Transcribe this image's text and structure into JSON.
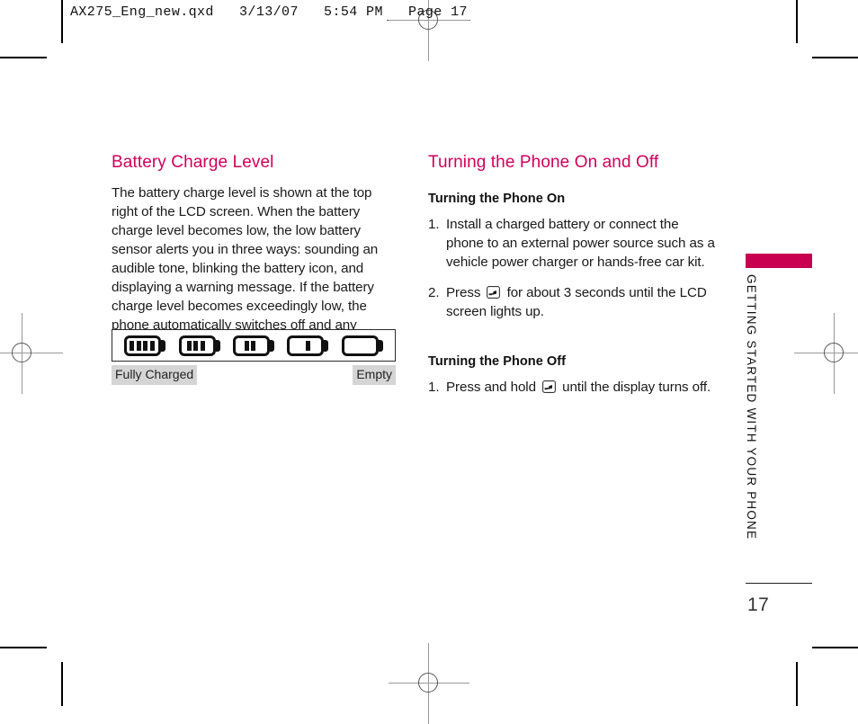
{
  "slug": "AX275_Eng_new.qxd   3/13/07   5:54 PM   Page 17",
  "colors": {
    "heading_crimson": "#d2005a",
    "tab_accent": "#c8004f",
    "label_chip_gray": "#d5d5d5",
    "body_text": "#1a1a1a"
  },
  "left_column": {
    "heading": "Battery Charge Level",
    "paragraph": "The battery charge level is shown at the top right of the LCD screen. When the battery charge level becomes low, the low battery sensor alerts you in three ways: sounding an audible tone, blinking the battery icon, and displaying a warning message. If the battery charge level becomes exceedingly low, the phone automatically switches off and any function in progress is not saved."
  },
  "battery_figure": {
    "icons": [
      {
        "bars": 4
      },
      {
        "bars": 3
      },
      {
        "bars": 2
      },
      {
        "bars": 1
      },
      {
        "bars": 0
      }
    ],
    "label_left": "Fully Charged",
    "label_right": "Empty"
  },
  "right_column": {
    "heading": "Turning the Phone On and Off",
    "on": {
      "subheading": "Turning the Phone On",
      "steps": [
        {
          "num": "1.",
          "text_before": "Install a charged battery or connect the phone to an external power source such as a vehicle power charger or hands-free car kit.",
          "icon": null,
          "text_after": ""
        },
        {
          "num": "2.",
          "text_before": "Press",
          "icon": "power-key-icon",
          "text_after": "for about 3 seconds until the LCD screen lights up."
        }
      ]
    },
    "off": {
      "subheading": "Turning the Phone Off",
      "steps": [
        {
          "num": "1.",
          "text_before": "Press and hold",
          "icon": "power-key-icon",
          "text_after": "until the display turns off."
        }
      ]
    }
  },
  "side_tab": {
    "label": "GETTING STARTED WITH YOUR PHONE"
  },
  "folio": {
    "page_number": "17"
  }
}
